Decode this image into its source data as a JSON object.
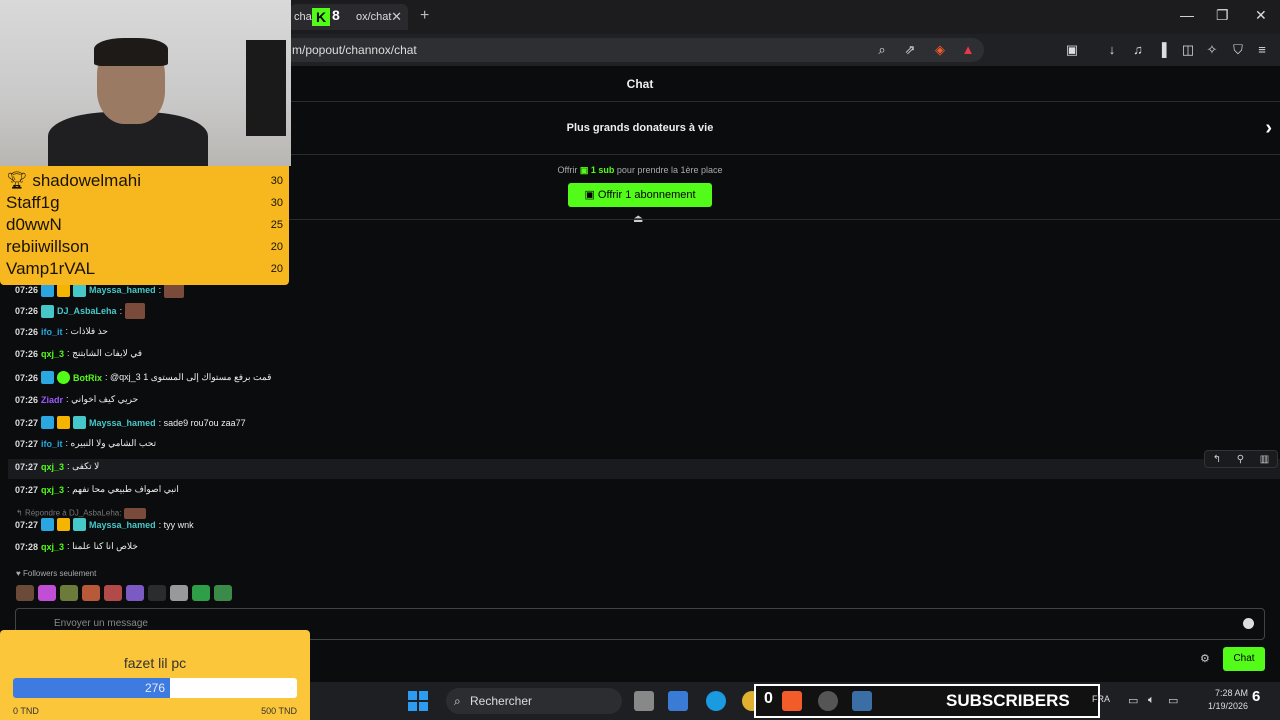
{
  "browser": {
    "tab_title": "chann",
    "tab_title_suffix": "ox/chat",
    "tab_logo": "K",
    "tab_logo_number": "8",
    "url": "m/popout/channox/chat",
    "new_tab": "+",
    "minimize": "—",
    "maximize": "❐",
    "close": "✕"
  },
  "chat": {
    "header": "Chat",
    "top_donors": "Plus grands donateurs à vie",
    "offer_prefix": "Offrir",
    "offer_sub": "1 sub",
    "offer_suffix": "pour prendre la 1ère place",
    "offer_button": "Offrir 1 abonnement",
    "messages": [
      {
        "time": "07:26",
        "user": "Mayssa_hamed",
        "user_color": "#47c8c8",
        "text": ":",
        "badges": [
          "b-blue",
          "b-gold",
          "b-teal"
        ],
        "emote": true
      },
      {
        "time": "07:26",
        "user": "DJ_AsbaLeha",
        "user_color": "#47c8c8",
        "text": ":",
        "badges": [
          "b-teal"
        ],
        "emote": true
      },
      {
        "time": "07:26",
        "user": "ifo_it",
        "user_color": "#2aa7e0",
        "text": ": حذ فلاذات",
        "badges": []
      },
      {
        "time": "07:26",
        "user": "qxj_3",
        "user_color": "#53fc18",
        "text": ": في لايفات الشابتنج",
        "badges": []
      },
      {
        "time": "07:26",
        "user": "BotRix",
        "user_color": "#53fc18",
        "text": ": @qxj_3 قمت برفع مستواك إلى المستوى 1",
        "badges": [
          "b-blue",
          "b-green"
        ]
      },
      {
        "time": "07:26",
        "user": "Ziadr",
        "user_color": "#9b59ff",
        "text": ": حريي كيف اخواني",
        "badges": []
      },
      {
        "time": "07:27",
        "user": "Mayssa_hamed",
        "user_color": "#47c8c8",
        "text": ": sade9 rou7ou zaa77",
        "badges": [
          "b-blue",
          "b-gold",
          "b-teal"
        ]
      },
      {
        "time": "07:27",
        "user": "ifo_it",
        "user_color": "#2aa7e0",
        "text": ": تحب الشامي ولا النبيره",
        "badges": []
      },
      {
        "time": "07:27",
        "user": "qxj_3",
        "user_color": "#53fc18",
        "text": ": لا تكفى",
        "badges": []
      },
      {
        "time": "07:27",
        "user": "qxj_3",
        "user_color": "#53fc18",
        "text": ": انبي اصواف طبيعي محا نفهم",
        "badges": []
      },
      {
        "time": "07:27",
        "user": "Mayssa_hamed",
        "user_color": "#47c8c8",
        "text": ": tyy wnk",
        "badges": [
          "b-blue",
          "b-gold",
          "b-teal"
        ]
      },
      {
        "time": "07:28",
        "user": "qxj_3",
        "user_color": "#53fc18",
        "text": ": خلاص انا كنا علمنا",
        "badges": []
      }
    ],
    "reply_to": "Répondre à DJ_AsbaLeha:",
    "followers_only": "Followers seulement",
    "input_placeholder": "Envoyer un message",
    "send_button": "Chat"
  },
  "leaderboard": [
    {
      "name": "shadowelmahi",
      "value": "30"
    },
    {
      "name": "Staff1g",
      "value": "30"
    },
    {
      "name": "d0wwN",
      "value": "25"
    },
    {
      "name": "rebiiwillson",
      "value": "20"
    },
    {
      "name": "Vamp1rVAL",
      "value": "20"
    }
  ],
  "goal": {
    "title": "fazet lil pc",
    "current": "276",
    "progress_fraction": 0.552,
    "min_label": "0 TND",
    "max_label": "500 TND"
  },
  "taskbar": {
    "search": "Rechercher",
    "subs_count": "0",
    "subs_label": "SUBSCRIBERS",
    "language": "FRA",
    "time": "7:28 AM",
    "date": "1/19/2026",
    "notifications": "6"
  },
  "colors": {
    "accent": "#53fc18",
    "leaderboard_bg": "#f6b81e",
    "goal_bg": "#fcc63a",
    "goal_fill": "#3d7be0"
  }
}
